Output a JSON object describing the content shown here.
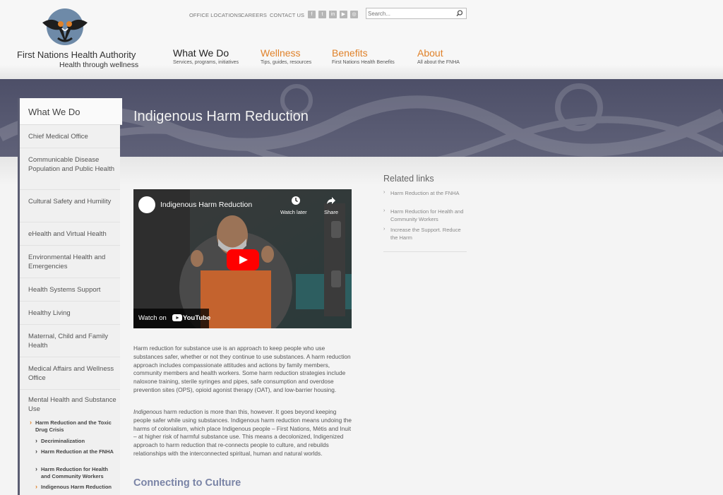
{
  "header": {
    "logo_name": "First Nations Health Authority",
    "logo_tagline": "Health through wellness",
    "utility_links": [
      "OFFICE LOCATIONS",
      "CAREERS",
      "CONTACT US"
    ],
    "social_icons": [
      "facebook-icon",
      "twitter-icon",
      "linkedin-icon",
      "youtube-icon",
      "instagram-icon"
    ],
    "search": {
      "placeholder": "Search...",
      "icon": "search-icon"
    }
  },
  "nav": [
    {
      "title": "What We Do",
      "subtitle": "Services, programs, initiatives",
      "color": "#222222"
    },
    {
      "title": "Wellness",
      "subtitle": "Tips, guides, resources",
      "color": "#e0822a"
    },
    {
      "title": "Benefits",
      "subtitle": "First Nations Health Benefits",
      "color": "#e0822a"
    },
    {
      "title": "About",
      "subtitle": "All about the FNHA",
      "color": "#e0822a"
    }
  ],
  "page": {
    "title": "Indigenous Harm Reduction"
  },
  "sidebar": {
    "heading": "What We Do",
    "items": [
      {
        "label": "Chief Medical Office"
      },
      {
        "label": "Communicable Disease Population and Public Health"
      },
      {
        "label": "Cultural Safety and Humility"
      },
      {
        "label": "eHealth and Virtual Health"
      },
      {
        "label": "Environmental Health and Emergencies"
      },
      {
        "label": "Health Systems Support"
      },
      {
        "label": "Healthy Living"
      },
      {
        "label": "Maternal, Child and Family Health"
      },
      {
        "label": "Medical Affairs and Wellness Office"
      },
      {
        "label": "Mental Health and Substance Use"
      }
    ],
    "subitems": [
      {
        "label": "Harm Reduction and the Toxic Drug Crisis"
      },
      {
        "label": "Decriminalization"
      },
      {
        "label": "Harm Reduction at the FNHA"
      },
      {
        "label": "Harm Reduction for Health and Community Workers"
      },
      {
        "label": "Indigenous Harm Reduction"
      }
    ]
  },
  "video": {
    "title": "Indigenous Harm Reduction",
    "watch_later": "Watch later",
    "share": "Share",
    "watch_on": "Watch on",
    "youtube": "YouTube"
  },
  "body": {
    "para1": "Harm reduction for substance use is an approach to keep people who use substances safer, whether or not they continue to use substances. A harm reduction approach includes compassionate attitudes and actions by family members, community members and health workers. Some harm reduction strategies include naloxone training, sterile syringes and pipes, safe consumption and overdose prevention sites (OPS), opioid agonist therapy (OAT), and low-barrier housing.",
    "para2_em": "Indigenous",
    "para2": " harm reduction is more than this, however. It goes beyond keeping people safer while using substances. Indigenous harm reduction means undoing the harms of colonialism, which place Indigenous people – First Nations, Métis and Inuit – at higher risk of harmful substance use. This means a decolonized, Indigenized approach to harm reduction that re-connects people to culture, and rebuilds relationships with the interconnected spiritual, human and natural worlds.",
    "heading2": "Connecting to Culture"
  },
  "related": {
    "title": "Related links",
    "links": [
      {
        "label": "Harm Reduction at the FNHA"
      },
      {
        "label": "Harm Reduction for Health and Community Workers"
      },
      {
        "label": "Increase the Support. Reduce the Harm"
      }
    ]
  },
  "colors": {
    "accent": "#e0822a",
    "banner": "#4d4f68",
    "sidebar_border": "#5b5d72"
  }
}
